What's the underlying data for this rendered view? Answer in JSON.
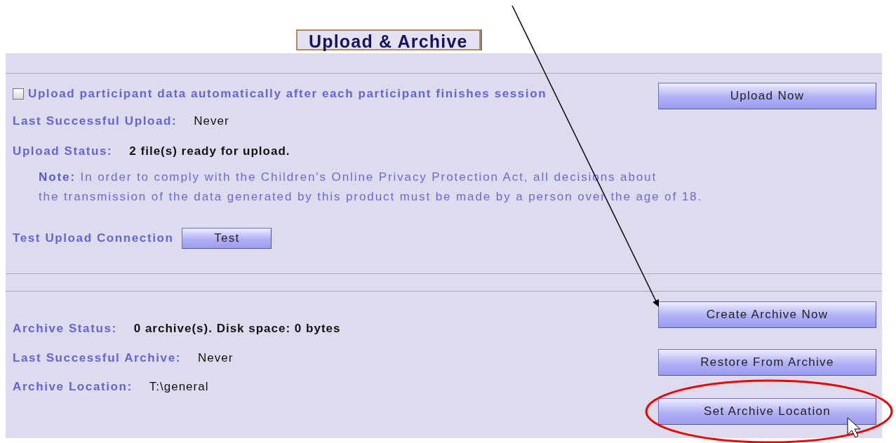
{
  "tab": {
    "label": "Upload & Archive"
  },
  "upload": {
    "auto_upload": {
      "label": "Upload participant data automatically after each participant finishes session",
      "checked": false
    },
    "button": "Upload Now",
    "fields": [
      {
        "label": "Last Successful Upload:",
        "value": "Never",
        "kind": "plain"
      },
      {
        "label": "Upload Status:",
        "value": "2 file(s) ready for upload.",
        "kind": "bold"
      }
    ],
    "note": [
      "**Note:**   In order to comply with the Children's Online Privacy Protection Act, all decisions about",
      "the transmission of the data generated by this product must be made by a person over the age of 18."
    ],
    "test": {
      "label": "Test Upload Connection",
      "button": "Test"
    }
  },
  "archive": {
    "fields": [
      {
        "label": "Archive Status:",
        "value": "0 archive(s).  Disk space: 0 bytes",
        "kind": "bold"
      },
      {
        "label": "Last Successful Archive:",
        "value": "Never",
        "kind": "plain"
      },
      {
        "label": "Archive Location:",
        "value": "T:\\general",
        "kind": "plain"
      }
    ],
    "buttons": [
      "Create Archive Now",
      "Restore From Archive",
      "Set Archive Location"
    ]
  }
}
